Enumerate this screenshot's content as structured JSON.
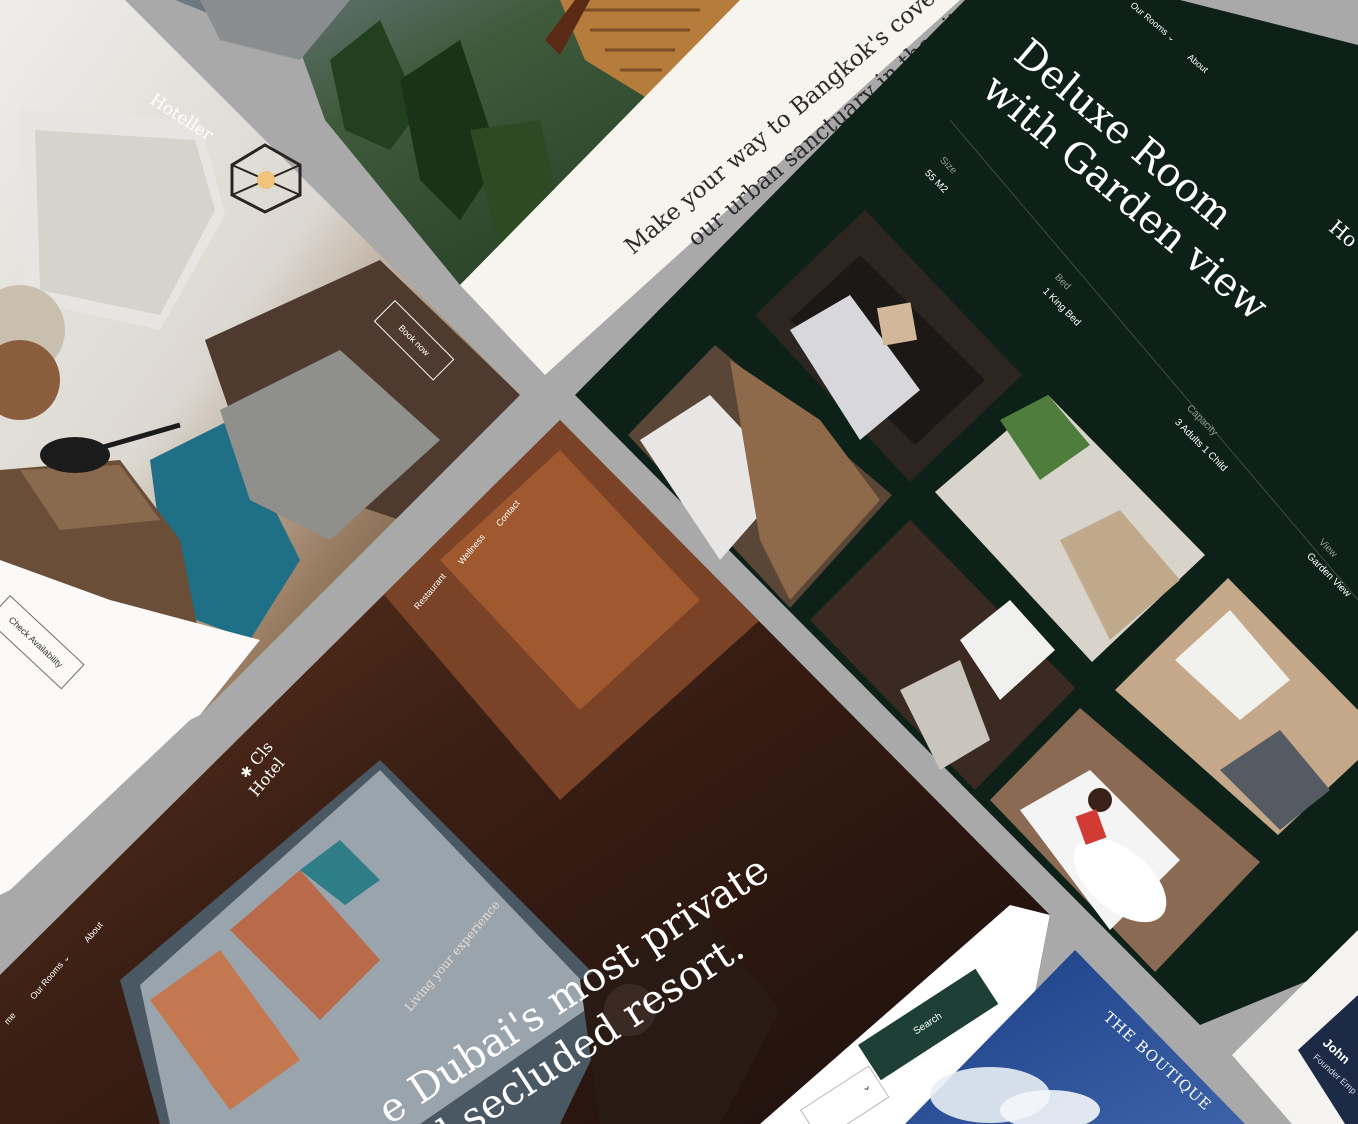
{
  "hoteller": {
    "brand": "Hoteller",
    "book_label": "Book now",
    "check_label": "Check Availability"
  },
  "bangkok": {
    "headline_line1": "Make your way to Bangkok's cove",
    "headline_line2": "our urban sanctuary in the city"
  },
  "deluxe": {
    "nav": {
      "rooms": "Our Rooms",
      "about": "About"
    },
    "title_line1": "Deluxe Room",
    "title_line2": "with Garden view",
    "brand_partial": "Ho",
    "specs": [
      {
        "label": "Size",
        "value": "55 M2"
      },
      {
        "label": "Bed",
        "value": "1 King Bed"
      },
      {
        "label": "Capacity",
        "value": "3 Adults 1 Child"
      },
      {
        "label": "View",
        "value": "Garden View"
      }
    ]
  },
  "dubai": {
    "logo_line1": "Cls",
    "logo_line2": "Hotel",
    "nav": {
      "home": "me",
      "rooms": "Our Rooms",
      "about": "About",
      "restaurant": "Restaurant",
      "wellness": "Wellness",
      "contact": "Contact"
    },
    "eyebrow": "Living your experience",
    "headline_line1": "e Dubai's most private",
    "headline_line2": "d secluded resort.",
    "search_label": "Search"
  },
  "boutique": {
    "brand": "THE BOUTIQUE"
  },
  "founder": {
    "name": "John",
    "role": "Founder Emp"
  },
  "colors": {
    "background": "#a9a9a9",
    "deep_green": "#0e2119",
    "cream": "#f6f3ec",
    "navy": "#1d3d7a",
    "search_green": "#1e3f36"
  },
  "icons": [
    "chevron-down-icon",
    "pendant-lamp-icon",
    "star-icon"
  ]
}
